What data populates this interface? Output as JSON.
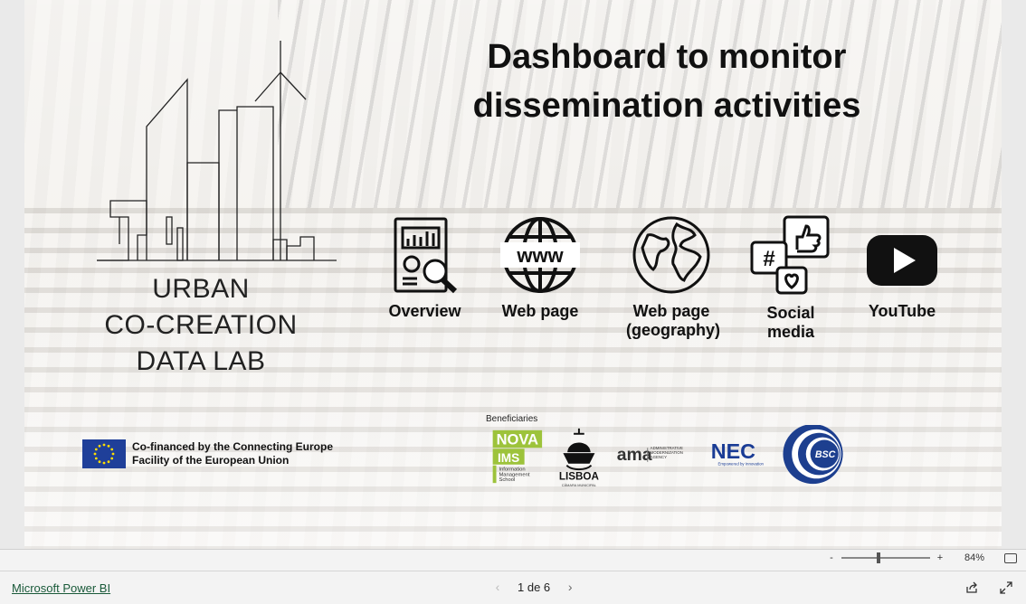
{
  "title": {
    "line1": "Dashboard to monitor",
    "line2": "dissemination activities"
  },
  "logo": {
    "line1": "URBAN",
    "line2": "CO-CREATION",
    "line3": "DATA LAB"
  },
  "nav": [
    {
      "label": "Overview",
      "icon": "report-magnifier-icon"
    },
    {
      "label": "Web page",
      "icon": "www-globe-icon"
    },
    {
      "label_line1": "Web page",
      "label_line2": "(geography)",
      "icon": "earth-globe-icon"
    },
    {
      "label": "Social media",
      "icon": "social-media-icon"
    },
    {
      "label": "YouTube",
      "icon": "youtube-icon"
    }
  ],
  "eu": {
    "line1": "Co-financed by the Connecting Europe",
    "line2": "Facility of the European Union"
  },
  "beneficiaries": {
    "label": "Beneficiaries",
    "nova_top": "NOVA",
    "nova_mid": "IMS",
    "nova_sub1": "Information",
    "nova_sub2": "Management",
    "nova_sub3": "School",
    "lisboa": "LISBOA",
    "lisboa_sub": "CÂMARA MUNICIPAL",
    "ama": "ama",
    "ama_sub1": "ADMINISTRATIVE",
    "ama_sub2": "MODERNIZATION",
    "ama_sub3": "AGENCY",
    "nec": "NEC",
    "nec_sub": "Empowered by Innovation",
    "bsc": "BSC"
  },
  "zoom": {
    "minus": "-",
    "plus": "+",
    "percent": "84%",
    "level": 0.42
  },
  "footer": {
    "brand": "Microsoft Power BI",
    "page": "1 de 6",
    "prev": "‹",
    "next": "›"
  },
  "colors": {
    "nova_green": "#9dc33b",
    "eu_blue": "#1f3f99",
    "eu_star": "#ffdd00",
    "bsc_blue": "#1d3f8f",
    "nec_blue": "#1a3c95",
    "youtube": "#111111"
  }
}
